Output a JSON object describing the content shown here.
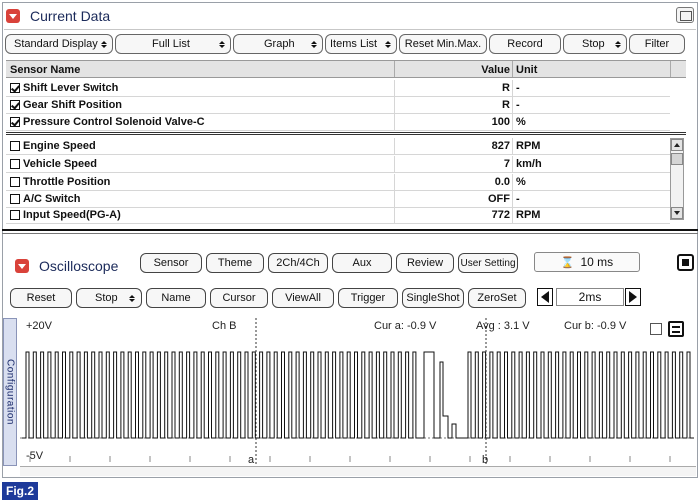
{
  "current_data": {
    "title": "Current Data",
    "toolbar": {
      "standard_display": "Standard Display",
      "full_list": "Full List",
      "graph": "Graph",
      "items_list": "Items List",
      "reset_min_max": "Reset Min.Max.",
      "record": "Record",
      "stop": "Stop",
      "filter": "Filter"
    },
    "columns": {
      "name": "Sensor Name",
      "value": "Value",
      "unit": "Unit"
    },
    "fixed_rows": [
      {
        "checked": true,
        "name": "Shift Lever Switch",
        "value": "R",
        "unit": "-"
      },
      {
        "checked": true,
        "name": "Gear Shift Position",
        "value": "R",
        "unit": "-"
      },
      {
        "checked": true,
        "name": "Pressure Control Solenoid Valve-C",
        "value": "100",
        "unit": "%"
      }
    ],
    "rows": [
      {
        "checked": false,
        "name": "Engine Speed",
        "value": "827",
        "unit": "RPM"
      },
      {
        "checked": false,
        "name": "Vehicle Speed",
        "value": "7",
        "unit": "km/h"
      },
      {
        "checked": false,
        "name": "Throttle Position",
        "value": "0.0",
        "unit": "%"
      },
      {
        "checked": false,
        "name": "A/C Switch",
        "value": "OFF",
        "unit": "-"
      },
      {
        "checked": false,
        "name": "Input Speed(PG-A)",
        "value": "772",
        "unit": "RPM"
      }
    ]
  },
  "oscilloscope": {
    "title": "Oscilloscope",
    "toolbar1": {
      "sensor": "Sensor",
      "theme": "Theme",
      "ch24": "2Ch/4Ch",
      "aux": "Aux",
      "review": "Review",
      "user_setting": "User Setting"
    },
    "time_value": "10 ms",
    "toolbar2": {
      "reset": "Reset",
      "stop": "Stop",
      "name": "Name",
      "cursor": "Cursor",
      "view_all": "ViewAll",
      "trigger": "Trigger",
      "single_shot": "SingleShot",
      "zero_set": "ZeroSet"
    },
    "time_scale": "2ms",
    "config_tab": "Configuration",
    "display": {
      "v_max": "+20V",
      "v_min": "-5V",
      "channel": "Ch B",
      "cur_a": "Cur a: -0.9 V",
      "avg": "Avg : 3.1 V",
      "cur_b": "Cur b: -0.9 V",
      "cursor_a": "a",
      "cursor_b": "b"
    },
    "colors": {
      "trace": "#111111",
      "cursor_line": "#333333"
    }
  },
  "figure_label": "Fig.2"
}
